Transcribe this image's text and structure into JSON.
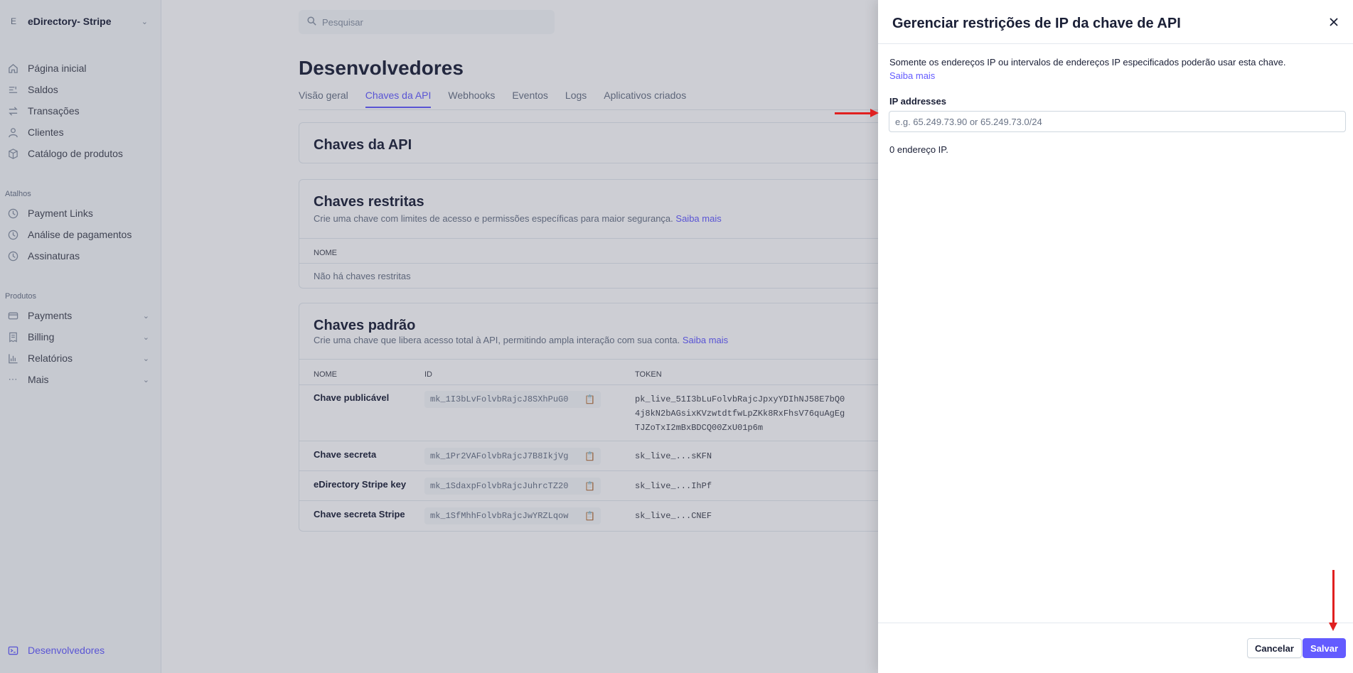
{
  "sidebar": {
    "account_initial": "E",
    "account_name": "eDirectory- Stripe",
    "items": [
      {
        "label": "Página inicial",
        "icon": "home-icon"
      },
      {
        "label": "Saldos",
        "icon": "balance-icon"
      },
      {
        "label": "Transações",
        "icon": "transactions-icon"
      },
      {
        "label": "Clientes",
        "icon": "customers-icon"
      },
      {
        "label": "Catálogo de produtos",
        "icon": "box-icon"
      }
    ],
    "shortcuts_title": "Atalhos",
    "shortcuts": [
      {
        "label": "Payment Links",
        "icon": "clock-icon"
      },
      {
        "label": "Análise de pagamentos",
        "icon": "clock-icon"
      },
      {
        "label": "Assinaturas",
        "icon": "clock-icon"
      }
    ],
    "products_title": "Produtos",
    "products": [
      {
        "label": "Payments",
        "icon": "payments-icon"
      },
      {
        "label": "Billing",
        "icon": "billing-icon"
      },
      {
        "label": "Relatórios",
        "icon": "reports-icon"
      },
      {
        "label": "Mais",
        "icon": "more-icon"
      }
    ],
    "developers_label": "Desenvolvedores"
  },
  "search": {
    "placeholder": "Pesquisar"
  },
  "page": {
    "title": "Desenvolvedores",
    "tabs": [
      "Visão geral",
      "Chaves da API",
      "Webhooks",
      "Eventos",
      "Logs",
      "Aplicativos criados"
    ],
    "active_tab": "Chaves da API"
  },
  "api_keys_card": {
    "title": "Chaves da API"
  },
  "restricted": {
    "title": "Chaves restritas",
    "description": "Crie uma chave com limites de acesso e permissões específicas para maior segurança.",
    "link": "Saiba mais",
    "column_name": "NOME",
    "empty": "Não há chaves restritas"
  },
  "standard": {
    "title": "Chaves padrão",
    "description": "Crie uma chave que libera acesso total à API, permitindo ampla interação com sua conta.",
    "link": "Saiba mais",
    "columns": [
      "NOME",
      "ID",
      "TOKEN"
    ],
    "rows": [
      {
        "name": "Chave publicável",
        "id": "mk_1I3bLvFolvbRajcJ8SXhPuG0",
        "token_lines": [
          "pk_live_51I3bLuFolvbRajcJpxyYDIhNJ58E7bQ0",
          "4j8kN2bAGsixKVzwtdtfwLpZKk8RxFhsV76quAgEg",
          "TJZoTxI2mBxBDCQ00ZxU01p6m"
        ]
      },
      {
        "name": "Chave secreta",
        "id": "mk_1Pr2VAFolvbRajcJ7B8IkjVg",
        "token_lines": [
          "sk_live_...sKFN"
        ]
      },
      {
        "name": "eDirectory Stripe key",
        "id": "mk_1SdaxpFolvbRajcJuhrcTZ20",
        "token_lines": [
          "sk_live_...IhPf"
        ]
      },
      {
        "name": "Chave secreta Stripe",
        "id": "mk_1SfMhhFolvbRajcJwYRZLqow",
        "token_lines": [
          "sk_live_...CNEF"
        ]
      }
    ]
  },
  "drawer": {
    "title": "Gerenciar restrições de IP da chave de API",
    "description": "Somente os endereços IP ou intervalos de endereços IP especificados poderão usar esta chave.",
    "link": "Saiba mais",
    "field_label": "IP addresses",
    "input_value": "",
    "input_placeholder": "e.g. 65.249.73.90 or 65.249.73.0/24",
    "count_text": "0 endereço IP.",
    "cancel_label": "Cancelar",
    "save_label": "Salvar"
  },
  "colors": {
    "accent": "#635bff",
    "annotation": "#e02020",
    "overlay": "rgba(60,66,87,0.26)"
  }
}
